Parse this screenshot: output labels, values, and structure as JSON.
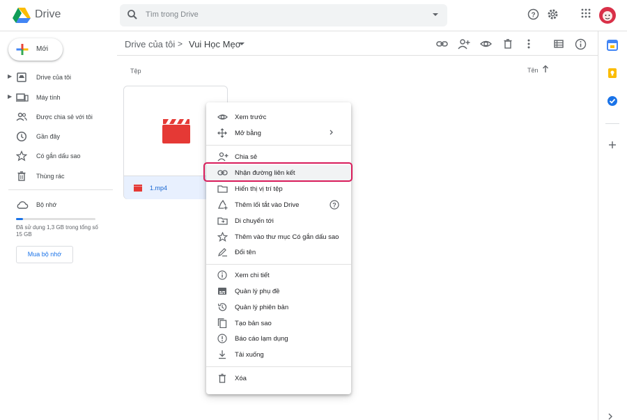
{
  "app": {
    "name": "Drive"
  },
  "search": {
    "placeholder": "Tìm trong Drive"
  },
  "new_button": {
    "label": "Mới"
  },
  "sidebar": {
    "items": [
      {
        "label": "Drive của tôi",
        "icon": "my-drive-icon"
      },
      {
        "label": "Máy tính",
        "icon": "computer-icon"
      },
      {
        "label": "Được chia sẻ với tôi",
        "icon": "shared-icon"
      },
      {
        "label": "Gần đây",
        "icon": "clock-icon"
      },
      {
        "label": "Có gắn dấu sao",
        "icon": "star-icon"
      },
      {
        "label": "Thùng rác",
        "icon": "trash-icon"
      }
    ],
    "storage_label": "Bộ nhớ",
    "storage_usage": "Đã sử dụng 1,3 GB trong tổng số 15 GB",
    "storage_fraction": 0.087,
    "buy_storage": "Mua bộ nhớ"
  },
  "breadcrumb": {
    "root": "Drive của tôi",
    "separator": ">",
    "current": "Vui Học Mẹo"
  },
  "files": {
    "section_label": "Tệp",
    "sort_label": "Tên",
    "items": [
      {
        "name": "1.mp4",
        "type": "video"
      }
    ]
  },
  "context_menu": {
    "items": [
      {
        "label": "Xem trước",
        "icon": "eye-icon"
      },
      {
        "label": "Mở bằng",
        "icon": "open-with-icon",
        "submenu": true
      },
      {
        "label": "Chia sẻ",
        "icon": "person-add-icon"
      },
      {
        "label": "Nhận đường liên kết",
        "icon": "link-icon",
        "highlighted": true
      },
      {
        "label": "Hiển thị vị trí tệp",
        "icon": "folder-icon"
      },
      {
        "label": "Thêm lối tắt vào Drive",
        "icon": "add-shortcut-icon",
        "help": true
      },
      {
        "label": "Di chuyển tới",
        "icon": "move-to-icon"
      },
      {
        "label": "Thêm vào thư mục Có gắn dấu sao",
        "icon": "star-icon"
      },
      {
        "label": "Đổi tên",
        "icon": "rename-icon"
      },
      {
        "label": "Xem chi tiết",
        "icon": "info-icon"
      },
      {
        "label": "Quản lý phụ đề",
        "icon": "subtitles-icon"
      },
      {
        "label": "Quản lý phiên bản",
        "icon": "history-icon"
      },
      {
        "label": "Tạo bản sao",
        "icon": "copy-icon"
      },
      {
        "label": "Báo cáo lạm dụng",
        "icon": "report-icon"
      },
      {
        "label": "Tải xuống",
        "icon": "download-icon"
      },
      {
        "label": "Xóa",
        "icon": "trash-icon"
      }
    ]
  },
  "colors": {
    "accent": "#1a73e8",
    "highlight_border": "#d81b5a",
    "video_red": "#e53935"
  }
}
